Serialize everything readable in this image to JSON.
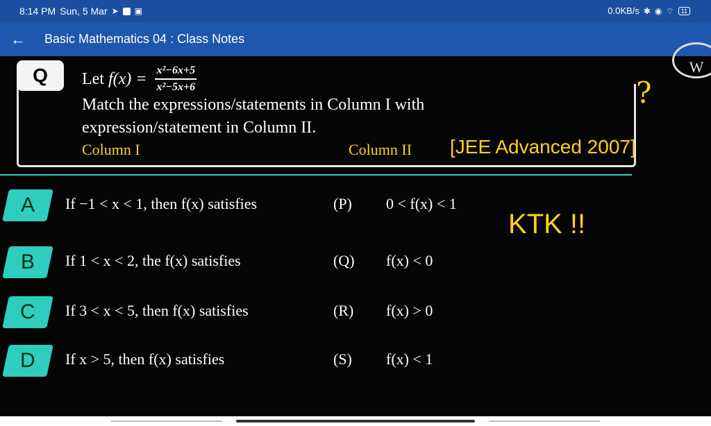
{
  "status_bar": {
    "time": "8:14 PM",
    "date": "Sun, 5 Mar",
    "speed": "0.0KB/s",
    "battery": "11"
  },
  "app_bar": {
    "back_icon": "arrow-left-icon",
    "title": "Basic Mathematics 04 : Class Notes"
  },
  "question": {
    "badge": "Q",
    "let_text": "Let",
    "function": "f(x) =",
    "numerator": "x²−6x+5",
    "denominator": "x²−5x+6",
    "line2": "Match the expressions/statements in Column I with",
    "line3": "expression/statement in Column II.",
    "column1": "Column I",
    "column2": "Column II",
    "source": "[JEE Advanced 2007]",
    "qmark": "?",
    "logo_letter": "W"
  },
  "options": [
    {
      "badge": "A",
      "text": "If −1 < x < 1, then f(x) satisfies",
      "label": "(P)",
      "expr": "0 < f(x) < 1"
    },
    {
      "badge": "B",
      "text": "If 1 < x < 2, the f(x) satisfies",
      "label": "(Q)",
      "expr": "f(x) < 0"
    },
    {
      "badge": "C",
      "text": "If 3 < x < 5, then f(x) satisfies",
      "label": "(R)",
      "expr": "f(x) > 0"
    },
    {
      "badge": "D",
      "text": "If x > 5, then f(x) satisfies",
      "label": "(S)",
      "expr": "f(x) < 1"
    }
  ],
  "note": "KTK !!"
}
